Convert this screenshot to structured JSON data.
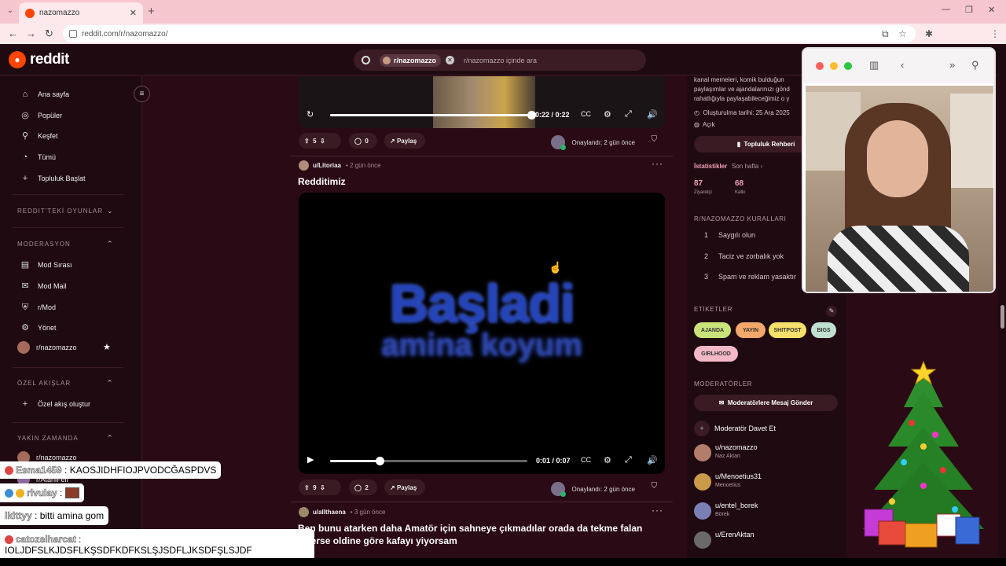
{
  "browser": {
    "tab_title": "nazomazzo",
    "url": "reddit.com/r/nazomazzo/"
  },
  "header": {
    "logo_text": "reddit",
    "search_chip": "r/nazomazzo",
    "search_placeholder": "r/nazomazzo içinde ara"
  },
  "sidebar": {
    "nav": [
      {
        "label": "Ana sayfa",
        "icon": "home-icon"
      },
      {
        "label": "Popüler",
        "icon": "popular-icon"
      },
      {
        "label": "Keşfet",
        "icon": "explore-icon"
      },
      {
        "label": "Tümü",
        "icon": "all-icon"
      },
      {
        "label": "Topluluk Başlat",
        "icon": "plus-icon"
      }
    ],
    "sections": {
      "games": "REDDIT'TEKİ OYUNLAR",
      "moderation": "MODERASYON",
      "custom_feeds": "ÖZEL AKIŞLAR",
      "recent": "YAKIN ZAMANDA"
    },
    "mod_items": [
      {
        "label": "Mod Sırası"
      },
      {
        "label": "Mod Mail"
      },
      {
        "label": "r/Mod"
      },
      {
        "label": "Yönet"
      },
      {
        "label": "r/nazomazzo"
      }
    ],
    "custom_feed_create": "Özel akış oluştur",
    "recent_items": [
      {
        "label": "r/nazomazzo"
      },
      {
        "label": "r/AtaniFeli"
      }
    ]
  },
  "feed": {
    "post1": {
      "time_display": "0:22 / 0:22",
      "progress": 1.0,
      "votes": "5",
      "comments": "0",
      "share": "Paylaş",
      "approved": "Onaylandı: 2 gün önce"
    },
    "post2": {
      "user": "u/Litoriaa",
      "time": "• 2 gün önce",
      "title": "Redditimiz",
      "video_text_1": "Başladi",
      "video_text_2": "amina koyum",
      "time_display": "0:01 / 0:07",
      "progress": 0.25,
      "votes": "9",
      "comments": "2",
      "share": "Paylaş",
      "approved": "Onaylandı: 2 gün önce"
    },
    "post3": {
      "user": "u/allthaena",
      "time": "• 3 gün önce",
      "text": "Ben bunu atarken daha Amatör için sahneye çıkmadılar orada da tekme falan eklerse oldine göre kafayı yiyorsam"
    }
  },
  "right_sidebar": {
    "about_lines": [
      "kanal memeleri, komik bulduğun",
      "paylaşımlar ve ajandalarınızı gönd",
      "rahatlığıyla paylaşabileceğimiz o y"
    ],
    "created": "Oluşturulma tarihi: 25 Ara 2025",
    "visibility": "Açık",
    "guide_button": "Topluluk Rehberi",
    "stats_label": "İstatistikler",
    "stats_range": "Son hafta",
    "stats": [
      {
        "value": "87",
        "label": "Ziyaretçi"
      },
      {
        "value": "68",
        "label": "Katkı"
      }
    ],
    "rules_title": "R/NAZOMAZZO KURALLARI",
    "rules": [
      {
        "n": "1",
        "text": "Saygılı olun"
      },
      {
        "n": "2",
        "text": "Taciz ve zorbalık yok"
      },
      {
        "n": "3",
        "text": "Spam ve reklam yasaktır"
      }
    ],
    "tags_title": "ETİKETLER",
    "tags": [
      {
        "label": "AJANDA",
        "color": "#c9e27a"
      },
      {
        "label": "YAYIN",
        "color": "#f2a86a"
      },
      {
        "label": "SHITPOST",
        "color": "#f4e06a"
      },
      {
        "label": "BIGS",
        "color": "#bfe0cf"
      },
      {
        "label": "GIRLHOOD",
        "color": "#f2b8c6"
      }
    ],
    "mods_title": "MODERATÖRLER",
    "message_mods": "Moderatörlere Mesaj Gönder",
    "invite_mod": "Moderatör Davet Et",
    "mods": [
      {
        "name": "u/nazomazzo",
        "sub": "Naz Aktan",
        "color": "#b27d6a"
      },
      {
        "name": "u/Menoetius31",
        "sub": "Menoetius",
        "color": "#c99a4a"
      },
      {
        "name": "u/entel_borek",
        "sub": "Börek",
        "color": "#7a7fb6"
      },
      {
        "name": "u/ErenAktan",
        "sub": "",
        "color": "#6a6a6a"
      }
    ]
  },
  "chat": [
    {
      "name": "Esma1459",
      "sep": " : ",
      "message": "KAOSJIDHFIOJPVODCĞASPDVS"
    },
    {
      "name": "rivulay",
      "sep": " :",
      "message": ""
    },
    {
      "name": "lkittyy",
      "sep": " : ",
      "message": "bitti amina gom"
    },
    {
      "name": "catozelharcat",
      "sep": " :",
      "message": "IOLJDFSLKJDSFLKŞSDFKDFKSLŞJSDFLJKSDFŞLSJDF"
    }
  ]
}
